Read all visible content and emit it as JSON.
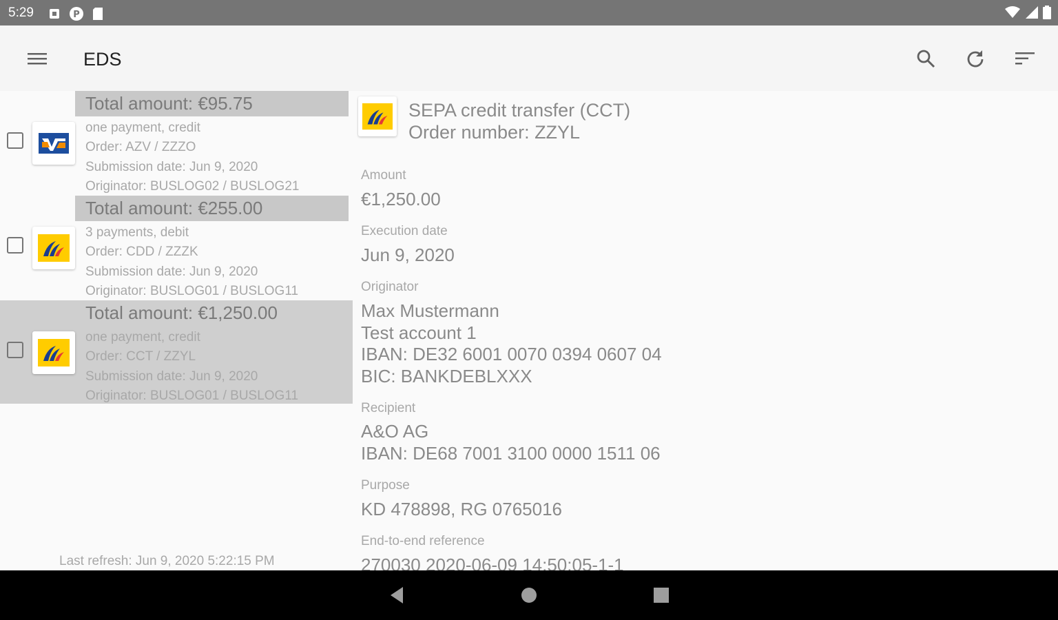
{
  "status_bar": {
    "time": "5:29"
  },
  "app_bar": {
    "title": "EDS",
    "menu_icon": "menu-icon",
    "actions": [
      "search-icon",
      "refresh-icon",
      "sort-icon"
    ]
  },
  "orders": [
    {
      "total": "Total amount: €95.75",
      "payments": "one payment, credit",
      "order": "Order: AZV / ZZZO",
      "submission": "Submission date: Jun 9, 2020",
      "originator": "Originator: BUSLOG02 / BUSLOG21",
      "bank_icon": "volksbank-logo-icon",
      "selected": false
    },
    {
      "total": "Total amount: €255.00",
      "payments": "3 payments, debit",
      "order": "Order: CDD / ZZZK",
      "submission": "Submission date: Jun 9, 2020",
      "originator": "Originator: BUSLOG01 / BUSLOG11",
      "bank_icon": "postbank-logo-icon",
      "selected": false
    },
    {
      "total": "Total amount: €1,250.00",
      "payments": "one payment, credit",
      "order": "Order: CCT / ZZYL",
      "submission": "Submission date: Jun 9, 2020",
      "originator": "Originator: BUSLOG01 / BUSLOG11",
      "bank_icon": "postbank-logo-icon",
      "selected": true
    }
  ],
  "last_refresh": "Last refresh: Jun 9, 2020 5:22:15 PM",
  "detail": {
    "title": "SEPA credit transfer (CCT)",
    "order_number": "Order number: ZZYL",
    "amount_label": "Amount",
    "amount": "€1,250.00",
    "execution_label": "Execution date",
    "execution_date": "Jun 9, 2020",
    "originator_label": "Originator",
    "originator_name": "Max Mustermann",
    "originator_account": "Test account 1",
    "originator_iban": "IBAN: DE32 6001 0070 0394 0607 04",
    "originator_bic": "BIC: BANKDEBLXXX",
    "recipient_label": "Recipient",
    "recipient_name": "A&O AG",
    "recipient_iban": "IBAN: DE68 7001 3100 0000 1511 06",
    "purpose_label": "Purpose",
    "purpose": "KD 478898, RG 0765016",
    "e2e_label": "End-to-end reference",
    "e2e": "270030 2020-06-09 14:50:05-1-1"
  },
  "colors": {
    "status_bar": "#757575",
    "app_bar": "#f5f5f5",
    "selected_row": "#cfcfcf",
    "total_bar": "#c8c8c8",
    "postbank_yellow": "#ffcc00",
    "postbank_blue": "#1a3d8f",
    "volksbank_blue": "#1d4e9e",
    "volksbank_orange": "#f28c00"
  }
}
